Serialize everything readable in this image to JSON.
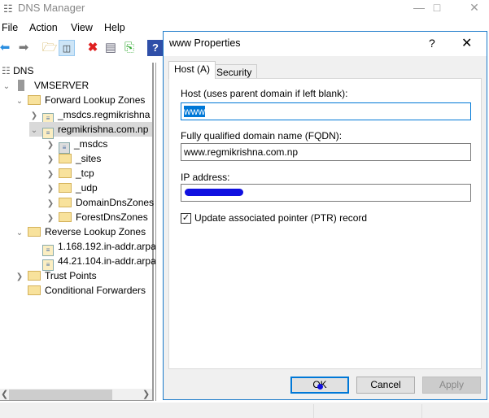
{
  "app": {
    "title": "DNS Manager"
  },
  "menu": [
    "File",
    "Action",
    "View",
    "Help"
  ],
  "tree": {
    "root": "DNS",
    "server": "VMSERVER",
    "forward": "Forward Lookup Zones",
    "msdcs_zone": "_msdcs.regmikrishna",
    "zone": "regmikrishna.com.np",
    "children": [
      "_msdcs",
      "_sites",
      "_tcp",
      "_udp",
      "DomainDnsZones",
      "ForestDnsZones"
    ],
    "reverse": "Reverse Lookup Zones",
    "reverse_zones": [
      "1.168.192.in-addr.arpa",
      "44.21.104.in-addr.arpa"
    ],
    "trust": "Trust Points",
    "conditional": "Conditional Forwarders"
  },
  "dialog": {
    "title": "www Properties",
    "help": "?",
    "tabs": [
      "Host (A)",
      "Security"
    ],
    "host_label": "Host (uses parent domain if left blank):",
    "host_value": "www",
    "fqdn_label": "Fully qualified domain name (FQDN):",
    "fqdn_value": "www.regmikrishna.com.np",
    "ip_label": "IP address:",
    "ptr_label": "Update associated pointer (PTR) record",
    "ptr_checked": true,
    "ok": "OK",
    "cancel": "Cancel",
    "apply": "Apply"
  }
}
